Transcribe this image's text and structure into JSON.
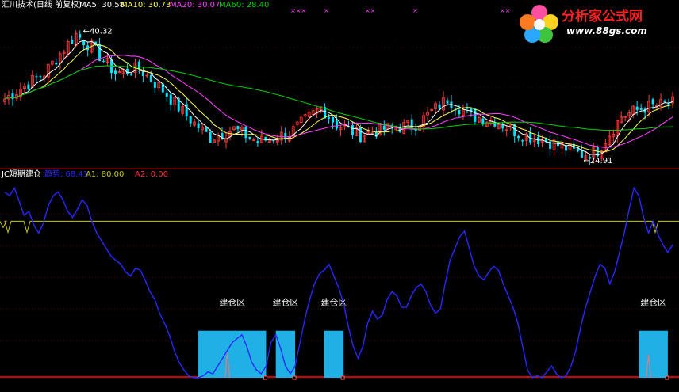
{
  "colors": {
    "background": "#000000",
    "divider": "#cc0000",
    "candle_up": "#ff3b3b",
    "candle_down": "#00e0ff",
    "ma5": "#ffffff",
    "ma10": "#ffff55",
    "ma20": "#ff44ff",
    "ma60": "#00d000",
    "indicator_line": "#2828ff",
    "a1_line": "#c8c800",
    "zone_fill": "#1fb0e6",
    "zone_label": "#ffffff",
    "price_marker": "#ffffff"
  },
  "price_panel": {
    "title": "汇川技术(日线 前复权)",
    "ma_labels": [
      {
        "text": "MA5: 30.58",
        "color": "#ffffff"
      },
      {
        "text": "MA10: 30.73",
        "color": "#ffff55"
      },
      {
        "text": "MA20: 30.07",
        "color": "#ff44ff"
      },
      {
        "text": "MA60: 28.40",
        "color": "#00d000"
      }
    ],
    "high_marker": "40.32",
    "low_marker": "24.91",
    "top_markers": [
      "×××",
      "×",
      "××",
      "×",
      "××",
      "×",
      "×"
    ]
  },
  "indicator_panel": {
    "title": "JC短期建仓",
    "series_label": "趋势: 68.41",
    "a1_label": "A1: 80.00",
    "a2_label": "A2: 0.00",
    "zone_label": "建仓区"
  },
  "logo": {
    "title": "分析家公式网",
    "url": "www.88gs.com"
  },
  "chart_data": [
    {
      "type": "line",
      "title": "汇川技术(日线 前复权)",
      "series": [
        {
          "name": "MA5",
          "last": 30.58
        },
        {
          "name": "MA10",
          "last": 30.73
        },
        {
          "name": "MA20",
          "last": 30.07
        },
        {
          "name": "MA60",
          "last": 28.4
        }
      ],
      "annotations": [
        {
          "text": "40.32",
          "kind": "high"
        },
        {
          "text": "24.91",
          "kind": "low"
        }
      ],
      "ylim": [
        24,
        42
      ]
    },
    {
      "type": "line",
      "title": "JC短期建仓",
      "ylim": [
        0,
        100
      ],
      "trend": [
        95,
        93,
        97,
        90,
        83,
        85,
        78,
        74,
        79,
        88,
        93,
        95,
        91,
        85,
        82,
        86,
        91,
        88,
        80,
        74,
        70,
        66,
        62,
        60,
        58,
        54,
        52,
        56,
        55,
        50,
        44,
        40,
        33,
        28,
        22,
        14,
        8,
        4,
        1,
        0,
        0,
        1,
        3,
        2,
        6,
        10,
        14,
        18,
        20,
        22,
        16,
        8,
        4,
        2,
        6,
        18,
        22,
        15,
        6,
        2,
        6,
        18,
        30,
        40,
        48,
        53,
        55,
        58,
        52,
        46,
        38,
        26,
        16,
        10,
        16,
        28,
        34,
        30,
        32,
        40,
        44,
        42,
        36,
        36,
        42,
        46,
        48,
        44,
        37,
        33,
        35,
        48,
        60,
        66,
        72,
        75,
        66,
        57,
        52,
        50,
        54,
        57,
        55,
        48,
        42,
        36,
        28,
        16,
        4,
        0,
        1,
        0,
        3,
        6,
        2,
        0,
        1,
        6,
        14,
        26,
        36,
        44,
        52,
        58,
        56,
        48,
        54,
        64,
        74,
        86,
        97,
        93,
        82,
        74,
        80,
        73,
        68,
        64,
        68
      ],
      "A1": 80.0,
      "A2": 0.0,
      "last": 68.41,
      "zones": [
        {
          "label": "建仓区",
          "start": 40,
          "end": 54
        },
        {
          "label": "建仓区",
          "start": 56,
          "end": 60
        },
        {
          "label": "建仓区",
          "start": 66,
          "end": 70
        },
        {
          "label": "建仓区",
          "start": 131,
          "end": 137
        },
        {
          "label": "建仓区",
          "start": 143,
          "end": 148
        }
      ]
    }
  ]
}
